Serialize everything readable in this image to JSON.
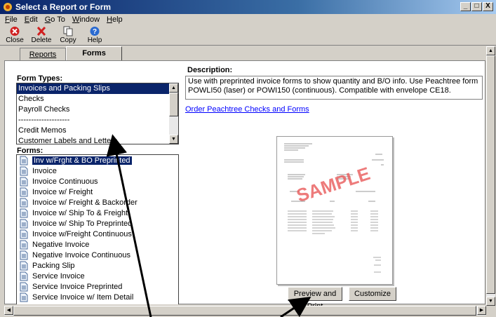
{
  "window": {
    "title": "Select a Report or Form",
    "buttons": [
      "_",
      "□",
      "X"
    ]
  },
  "menubar": [
    {
      "label": "File",
      "u": "F",
      "rest": "ile"
    },
    {
      "label": "Edit",
      "u": "E",
      "rest": "dit"
    },
    {
      "label": "Go To",
      "u": "G",
      "rest": "o To"
    },
    {
      "label": "Window",
      "u": "W",
      "rest": "indow"
    },
    {
      "label": "Help",
      "u": "H",
      "rest": "elp"
    }
  ],
  "toolbar": {
    "close": "Close",
    "delete": "Delete",
    "copy": "Copy",
    "help": "Help"
  },
  "tabs": {
    "reports": "Reports",
    "forms": "Forms"
  },
  "form_types": {
    "label": "Form Types:",
    "items": [
      "Invoices and Packing Slips",
      "Checks",
      "Payroll Checks",
      "--------------------",
      "Credit Memos",
      "Customer Labels and Letters"
    ],
    "selected": 0
  },
  "forms": {
    "label": "Forms:",
    "items": [
      "Inv w/Frght & BO Preprinted",
      "Invoice",
      "Invoice Continuous",
      "Invoice w/ Freight",
      "Invoice w/ Freight & Backorder",
      "Invoice w/ Ship To & Freight",
      "Invoice w/ Ship To Preprinted",
      "Invoice w/Freight Continuous",
      "Negative Invoice",
      "Negative Invoice Continuous",
      "Packing Slip",
      "Service Invoice",
      "Service Invoice Preprinted",
      "Service Invoice w/ Item Detail"
    ],
    "selected": 0
  },
  "description": {
    "label": "Description:",
    "text": "Use with preprinted invoice forms to show quantity and B/O info. Use Peachtree form POWLI50 (laser) or POWI150 (continuous). Compatible with envelope CE18."
  },
  "order_link": "Order Peachtree Checks and Forms",
  "preview": {
    "watermark": "SAMPLE"
  },
  "buttons": {
    "preview_print": "Preview and Print",
    "customize": "Customize"
  }
}
